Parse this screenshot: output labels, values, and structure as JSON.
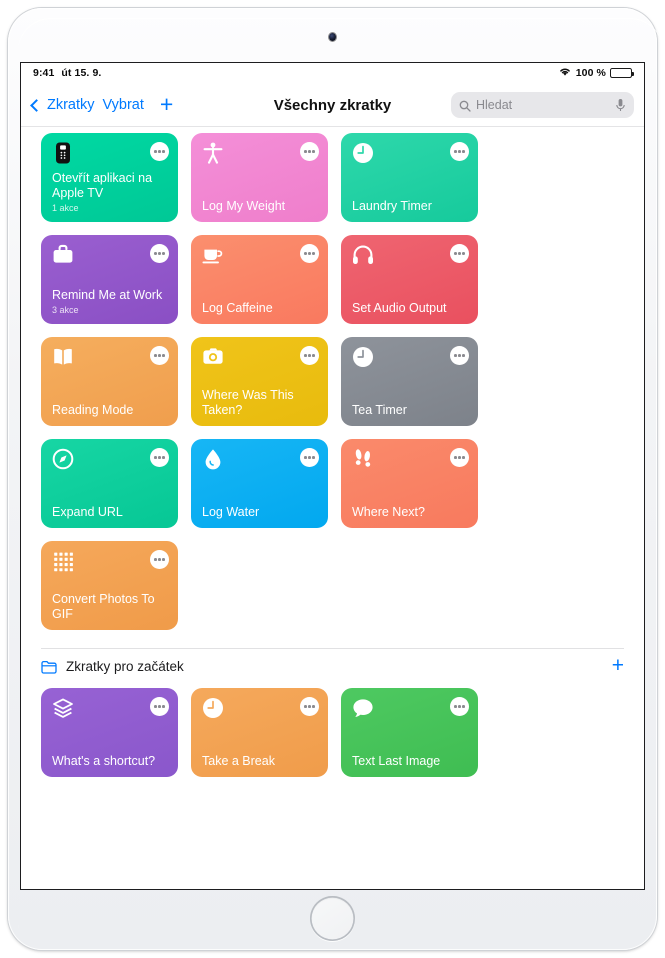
{
  "device": {
    "camera": "front-camera",
    "home_button": "home-button"
  },
  "status_bar": {
    "time": "9:41",
    "date": "út 15. 9.",
    "wifi_icon": "wifi-icon",
    "battery_percent": "100 %",
    "battery_icon": "battery-full-icon"
  },
  "nav": {
    "back_label": "Zkratky",
    "select_label": "Vybrat",
    "add_label": "+",
    "title": "Všechny zkratky"
  },
  "search": {
    "placeholder": "Hledat",
    "search_icon": "search-icon",
    "mic_icon": "microphone-icon"
  },
  "shortcuts": [
    {
      "name": "Otevřít aplikaci na Apple TV",
      "subtitle": "1 akce",
      "icon": "apple-tv-remote-icon",
      "color_start": "#00d9a3",
      "color_end": "#00c896"
    },
    {
      "name": "Log My Weight",
      "subtitle": "",
      "icon": "person-accessibility-icon",
      "color_start": "#f48fd8",
      "color_end": "#ef7ecb"
    },
    {
      "name": "Laundry Timer",
      "subtitle": "",
      "icon": "clock-icon",
      "color_start": "#2ed8ab",
      "color_end": "#16ca9c"
    },
    {
      "name": "Remind Me at Work",
      "subtitle": "3 akce",
      "icon": "briefcase-icon",
      "color_start": "#9a5fd0",
      "color_end": "#8a4fc4"
    },
    {
      "name": "Log Caffeine",
      "subtitle": "",
      "icon": "coffee-cup-icon",
      "color_start": "#fb8f6e",
      "color_end": "#f9795f"
    },
    {
      "name": "Set Audio Output",
      "subtitle": "",
      "icon": "headphones-icon",
      "color_start": "#ef6571",
      "color_end": "#e9505f"
    },
    {
      "name": "Reading Mode",
      "subtitle": "",
      "icon": "open-book-icon",
      "color_start": "#f5ae5e",
      "color_end": "#f09e4d"
    },
    {
      "name": "Where Was This Taken?",
      "subtitle": "",
      "icon": "camera-icon",
      "color_start": "#f0c41a",
      "color_end": "#e8bb0d"
    },
    {
      "name": "Tea Timer",
      "subtitle": "",
      "icon": "clock-icon",
      "color_start": "#8e939b",
      "color_end": "#7d828a"
    },
    {
      "name": "Expand URL",
      "subtitle": "",
      "icon": "safari-compass-icon",
      "color_start": "#17d6a4",
      "color_end": "#06c795"
    },
    {
      "name": "Log Water",
      "subtitle": "",
      "icon": "water-drop-icon",
      "color_start": "#17b6f5",
      "color_end": "#02a8ef"
    },
    {
      "name": "Where Next?",
      "subtitle": "",
      "icon": "footsteps-icon",
      "color_start": "#fa8a6b",
      "color_end": "#f87a5e"
    },
    {
      "name": "Convert Photos To GIF",
      "subtitle": "",
      "icon": "grid-dots-icon",
      "color_start": "#f5a85b",
      "color_end": "#f09b49"
    }
  ],
  "starter_section": {
    "folder_icon": "folder-icon",
    "title": "Zkratky pro začátek",
    "add_label": "+",
    "shortcuts": [
      {
        "name": "What's a shortcut?",
        "subtitle": "",
        "icon": "layers-icon",
        "color_start": "#9762d4",
        "color_end": "#8a57cb"
      },
      {
        "name": "Take a Break",
        "subtitle": "",
        "icon": "clock-icon",
        "color_start": "#f5a95c",
        "color_end": "#f09c4a"
      },
      {
        "name": "Text Last Image",
        "subtitle": "",
        "icon": "chat-bubble-icon",
        "color_start": "#4ec961",
        "color_end": "#3fbd52"
      }
    ]
  },
  "more_button_label": "…"
}
